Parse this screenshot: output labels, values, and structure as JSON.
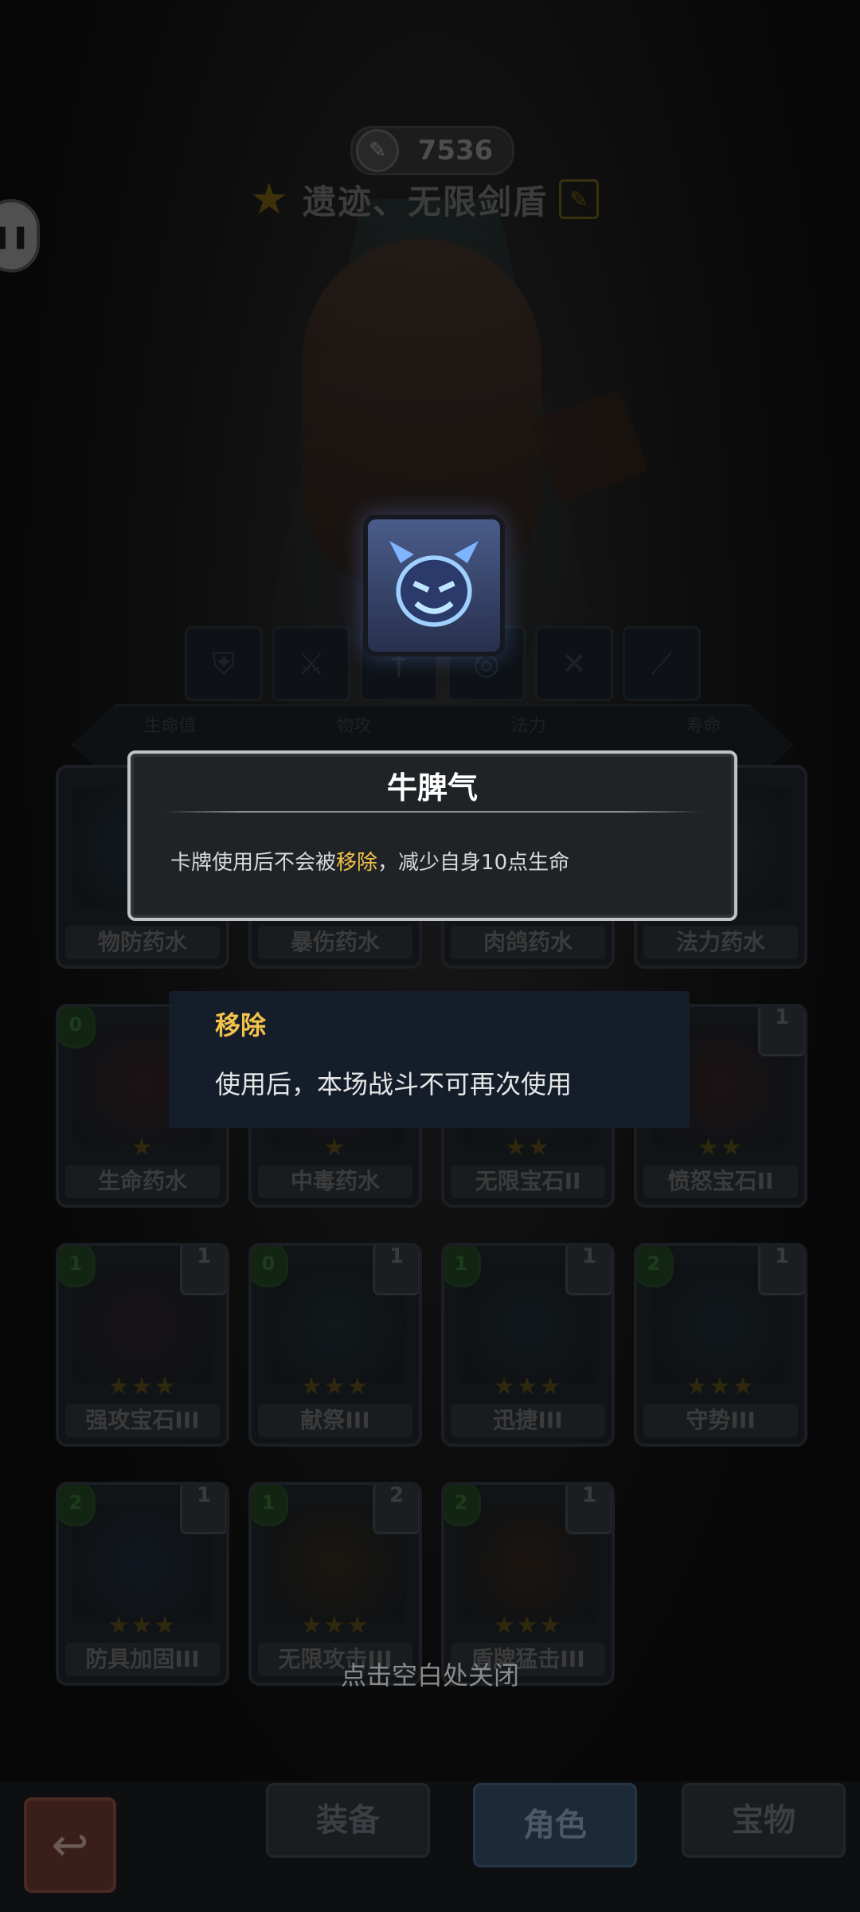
{
  "currency": {
    "value": "7536",
    "icon": "quill-icon"
  },
  "hero": {
    "title": "遗迹、无限剑盾",
    "star_icon": "star-icon",
    "edit_icon": "edit-icon"
  },
  "stats": {
    "labels": [
      "生命值",
      "物攻",
      "法力",
      "寿命"
    ]
  },
  "cards": [
    {
      "name": "物防药水",
      "stars": "★",
      "color": "#1d3540"
    },
    {
      "name": "暴伤药水",
      "stars": "★",
      "color": "#1d3a28"
    },
    {
      "name": "肉鸽药水",
      "stars": "★",
      "color": "#3a3620"
    },
    {
      "name": "法力药水",
      "stars": "★",
      "color": "#2c2c3c"
    },
    {
      "name": "生命药水",
      "stars": "★",
      "cost": "0",
      "color": "#3a1a1a"
    },
    {
      "name": "中毒药水",
      "stars": "★",
      "color": "#2d1a3a"
    },
    {
      "name": "无限宝石II",
      "stars": "★★",
      "color": "#2a2a2a"
    },
    {
      "name": "愤怒宝石II",
      "stars": "★★",
      "layer": "1",
      "color": "#3a1a1a"
    },
    {
      "name": "强攻宝石III",
      "stars": "★★★",
      "cost": "1",
      "layer": "1",
      "color": "#2d1a2a"
    },
    {
      "name": "献祭III",
      "stars": "★★★",
      "cost": "0",
      "layer": "1",
      "color": "#1a3032"
    },
    {
      "name": "迅捷III",
      "stars": "★★★",
      "cost": "1",
      "layer": "1",
      "color": "#1a2a30"
    },
    {
      "name": "守势III",
      "stars": "★★★",
      "cost": "2",
      "layer": "1",
      "color": "#1a2a30"
    },
    {
      "name": "防具加固III",
      "stars": "★★★",
      "cost": "2",
      "layer": "1",
      "color": "#1a2a3a"
    },
    {
      "name": "无限攻击III",
      "stars": "★★★",
      "cost": "1",
      "layer": "2",
      "color": "#3a2a10"
    },
    {
      "name": "盾牌猛击III",
      "stars": "★★★",
      "cost": "2",
      "layer": "1",
      "color": "#3a2410"
    }
  ],
  "tooltip": {
    "title": "牛脾气",
    "desc_before": "卡牌使用后不会被",
    "desc_highlight": "移除",
    "desc_after": "，减少自身10点生命"
  },
  "keyword": {
    "term": "移除",
    "desc": "使用后，本场战斗不可再次使用"
  },
  "close_hint": "点击空白处关闭",
  "tabs": {
    "equip": "装备",
    "role": "角色",
    "treasure": "宝物"
  },
  "back_icon": "return-arrow-icon"
}
